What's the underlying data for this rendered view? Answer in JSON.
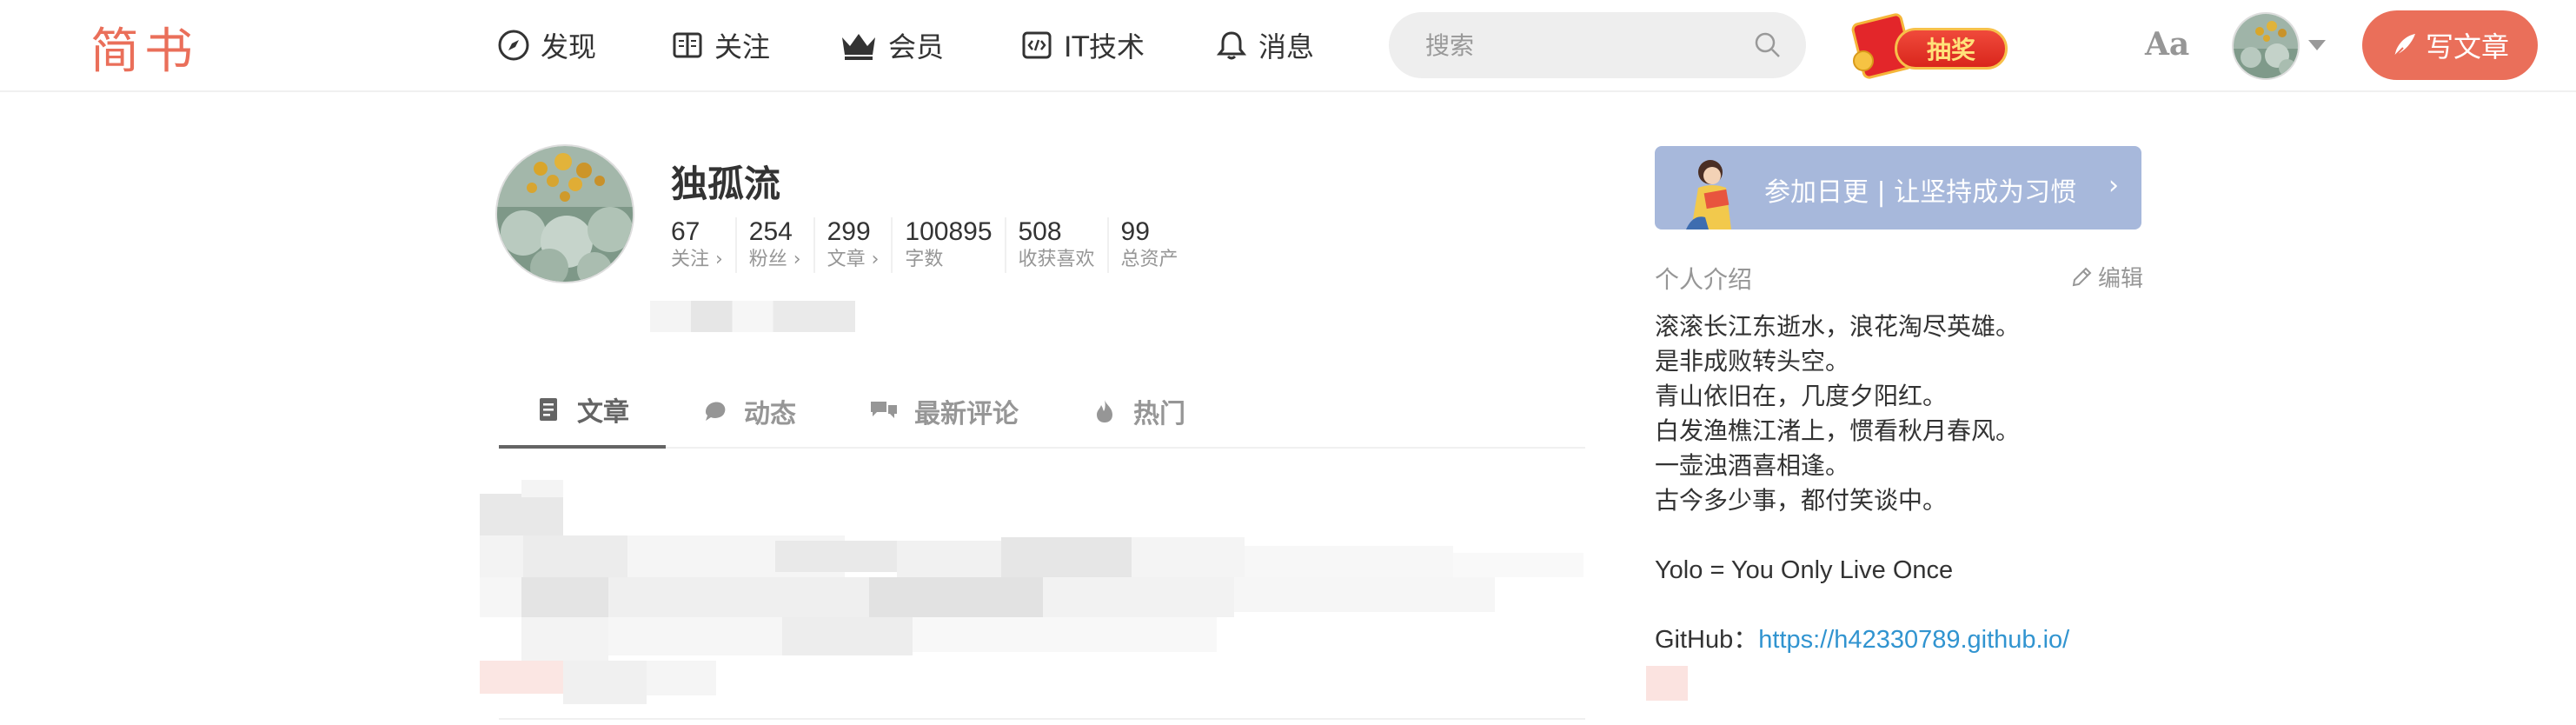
{
  "header": {
    "logo": "简书",
    "nav": [
      {
        "label": "发现",
        "icon": "compass-icon"
      },
      {
        "label": "关注",
        "icon": "book-icon"
      },
      {
        "label": "会员",
        "icon": "crown-icon"
      },
      {
        "label": "IT技术",
        "icon": "code-icon"
      },
      {
        "label": "消息",
        "icon": "bell-icon"
      }
    ],
    "search": {
      "placeholder": "搜索"
    },
    "lottery_label": "抽奖",
    "font_toggle": "Aa",
    "write_label": "写文章"
  },
  "profile": {
    "name": "独孤流",
    "stats": [
      {
        "value": "67",
        "label": "关注 ›"
      },
      {
        "value": "254",
        "label": "粉丝 ›"
      },
      {
        "value": "299",
        "label": "文章 ›"
      },
      {
        "value": "100895",
        "label": "字数"
      },
      {
        "value": "508",
        "label": "收获喜欢"
      },
      {
        "value": "99",
        "label": "总资产"
      }
    ]
  },
  "tabs": [
    {
      "label": "文章",
      "icon": "document-icon",
      "active": true
    },
    {
      "label": "动态",
      "icon": "activity-icon",
      "active": false
    },
    {
      "label": "最新评论",
      "icon": "comments-icon",
      "active": false
    },
    {
      "label": "热门",
      "icon": "fire-icon",
      "active": false
    }
  ],
  "sidebar": {
    "banner": {
      "text": "参加日更 | 让坚持成为习惯",
      "arrow": "›"
    },
    "intro_title": "个人介绍",
    "edit_label": "编辑",
    "intro_lines": [
      "滚滚长江东逝水，浪花淘尽英雄。",
      "是非成败转头空。",
      "青山依旧在，几度夕阳红。",
      "白发渔樵江渚上，惯看秋月春风。",
      "一壶浊酒喜相逢。",
      "古今多少事，都付笑谈中。"
    ],
    "motto": "Yolo = You Only Live Once",
    "github_label": "GitHub：",
    "github_url": "https://h42330789.github.io/"
  },
  "colors": {
    "brand": "#ea6f5a",
    "link": "#3194d0",
    "banner": "#a7b8db",
    "muted": "#969696"
  }
}
